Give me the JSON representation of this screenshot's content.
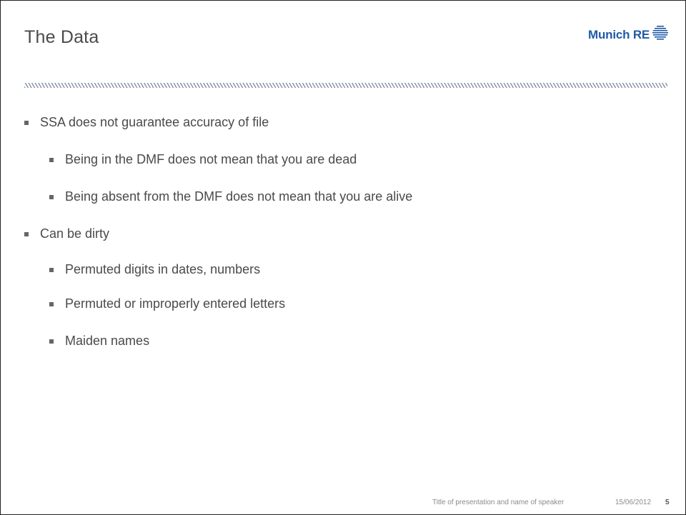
{
  "slide": {
    "title": "The Data",
    "logo": {
      "text": "Munich RE",
      "mark_icon": "munich-re-stripes",
      "color": "#1f5aa8"
    },
    "bullets": [
      {
        "level": 1,
        "text": "SSA does not guarantee accuracy of file"
      },
      {
        "level": 2,
        "text": "Being in the DMF does not mean that you are dead"
      },
      {
        "level": 2,
        "text": "Being absent from the DMF does not mean that you are alive"
      },
      {
        "level": 1,
        "text": "Can be dirty"
      },
      {
        "level": 2,
        "text": "Permuted digits in dates, numbers"
      },
      {
        "level": 2,
        "text": "Permuted or improperly entered letters"
      },
      {
        "level": 2,
        "text": "Maiden names"
      }
    ],
    "footer": {
      "presentation_title": "Title of presentation and name of speaker",
      "date": "15/06/2012",
      "page_number": "5"
    },
    "colors": {
      "title_text": "#4a4a4a",
      "bullet_square": "#666666",
      "hatch_line": "#7e8aa0"
    }
  }
}
